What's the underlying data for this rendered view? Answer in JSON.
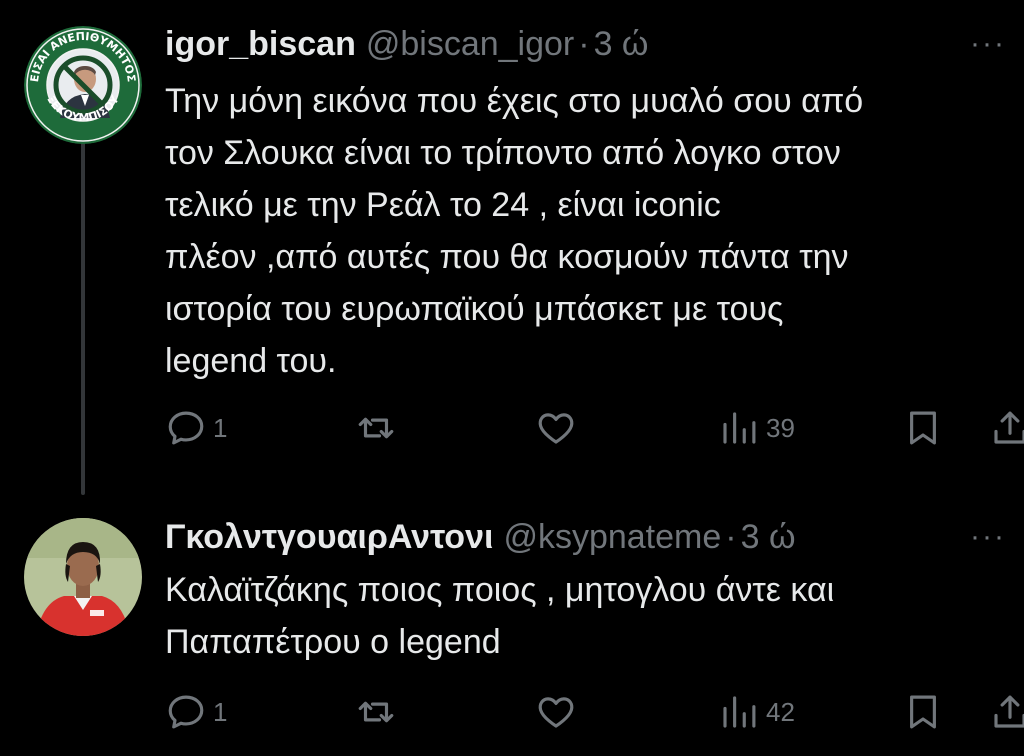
{
  "tweets": [
    {
      "display_name": "igor_biscan",
      "handle": "@biscan_igor",
      "separator": "·",
      "time": "3 ώ",
      "more_label": "···",
      "avatar": {
        "icon": "crossed-out-portrait-badge",
        "badge_text_top": "ΕΙΣΑΙ ΑΝΕΠΙΘΥΜΗΤΟΣ",
        "badge_text_bottom": "ΞΕΚΟΥΜΠΙΣΟΥ",
        "colors": {
          "ring": "#1e6b3a",
          "inner": "#e9ecef",
          "cross": "#1a4d2a"
        }
      },
      "text_lines": [
        "Την μόνη εικόνα που έχεις στο μυαλό σου από",
        "τον Σλουκα είναι το τρίποντο από λογκο στον",
        "τελικό με την Ρεάλ το 24 , είναι iconic",
        "πλέον ,από αυτές που θα κοσμούν πάντα την",
        "ιστορία του ευρωπαϊκού μπάσκετ με τους",
        "legend του."
      ],
      "actions": {
        "replies": "1",
        "retweets": "",
        "likes": "",
        "views": "39"
      }
    },
    {
      "display_name": "ΓκολντγουαιρΑντονι",
      "handle": "@ksypnateme",
      "separator": "·",
      "time": "3 ώ",
      "more_label": "···",
      "avatar": {
        "icon": "footballer-photo",
        "colors": {
          "shirt": "#d8322e",
          "bg": "#b7c39a",
          "skin": "#9a6b4f",
          "hair": "#1a1410"
        }
      },
      "text_lines": [
        "Καλαϊτζάκης  ποιος ποιος , μητογλου άντε και",
        "Παπαπέτρου ο legend"
      ],
      "actions": {
        "replies": "1",
        "retweets": "",
        "likes": "",
        "views": "42"
      }
    }
  ],
  "theme": {
    "background": "#000000",
    "text": "#e7e9ea",
    "muted": "#71767b",
    "thread_line": "#333639"
  }
}
